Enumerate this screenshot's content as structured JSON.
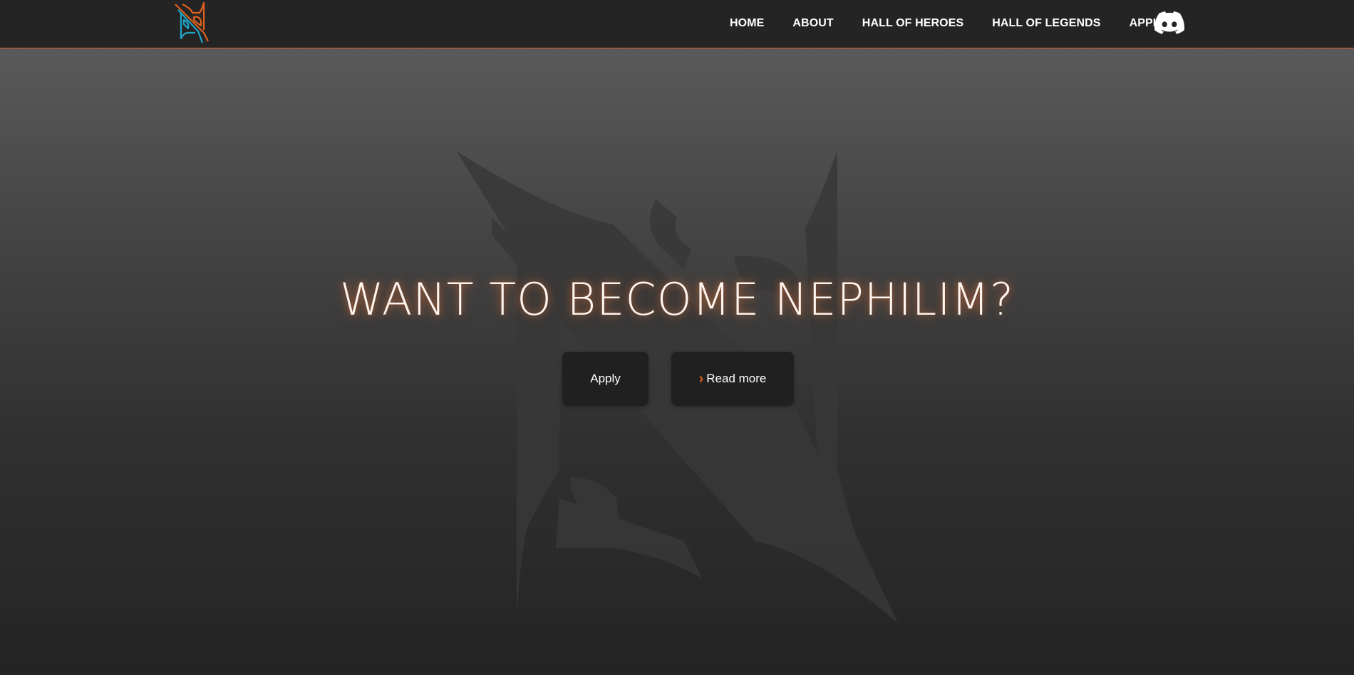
{
  "nav": {
    "links": [
      {
        "label": "HOME"
      },
      {
        "label": "ABOUT"
      },
      {
        "label": "HALL OF HEROES"
      },
      {
        "label": "HALL OF LEGENDS"
      },
      {
        "label": "APPLY"
      }
    ],
    "logo_icon": "nephilim-logo-icon",
    "discord_icon": "discord-icon"
  },
  "hero": {
    "title": "WANT TO BECOME NEPHILIM?",
    "apply_label": "Apply",
    "read_more_label": "Read more",
    "watermark_icon": "nephilim-emblem-icon"
  },
  "colors": {
    "accent": "#e0621e",
    "logo_secondary": "#1fa6c9",
    "navbar_bg": "#242424",
    "button_bg": "#202020"
  }
}
